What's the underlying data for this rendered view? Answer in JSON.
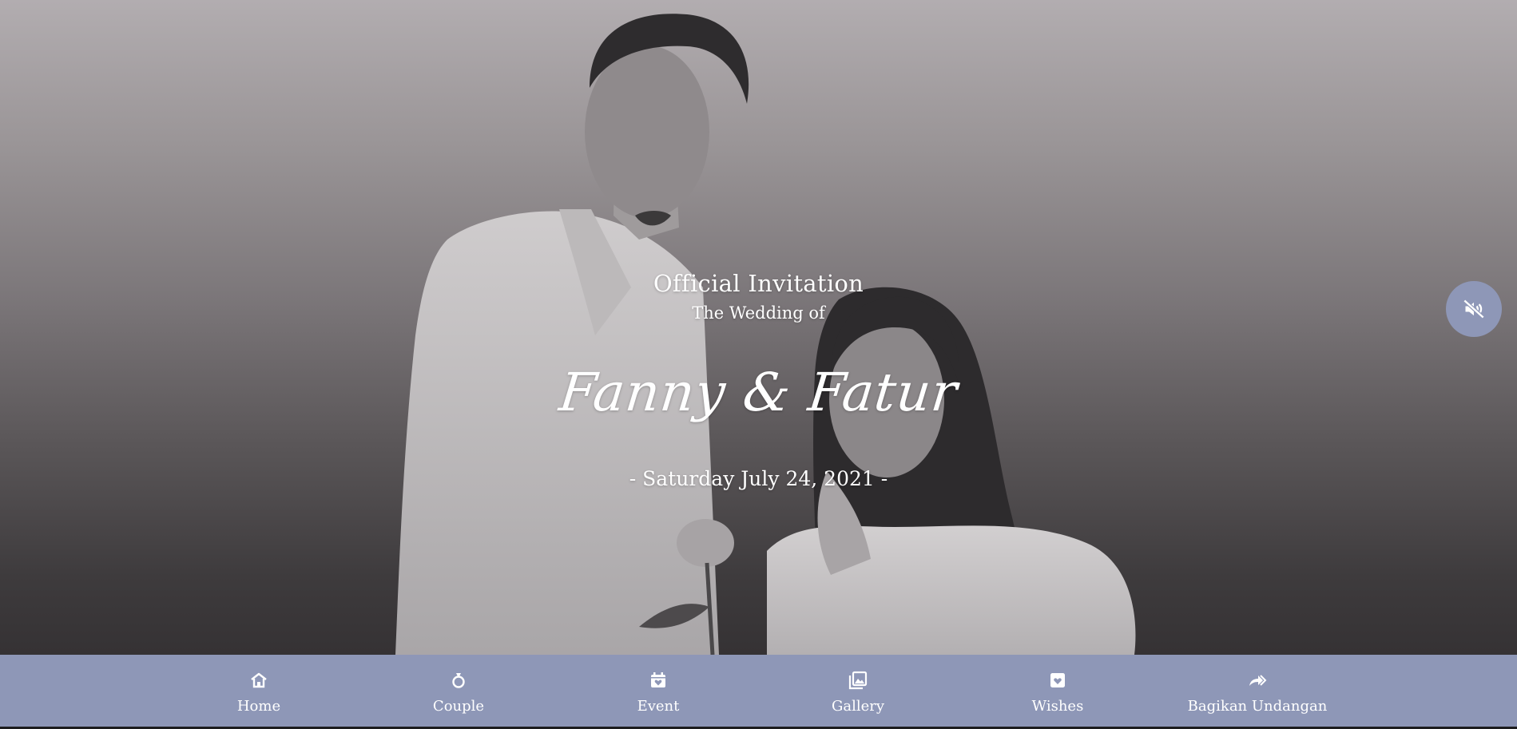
{
  "hero": {
    "heading": "Official Invitation",
    "subheading": "The Wedding of",
    "names": "Fanny & Fatur",
    "date": "- Saturday July 24, 2021 -"
  },
  "sound_button": {
    "icon": "volume-mute-icon",
    "state": "muted"
  },
  "nav": {
    "items": [
      {
        "label": "Home",
        "icon": "home-icon"
      },
      {
        "label": "Couple",
        "icon": "ring-icon"
      },
      {
        "label": "Event",
        "icon": "calendar-heart-icon"
      },
      {
        "label": "Gallery",
        "icon": "gallery-icon"
      },
      {
        "label": "Wishes",
        "icon": "heart-box-icon"
      },
      {
        "label": "Bagikan Undangan",
        "icon": "share-icon"
      }
    ]
  },
  "colors": {
    "accent": "#8e97b7",
    "text": "#ffffff"
  }
}
